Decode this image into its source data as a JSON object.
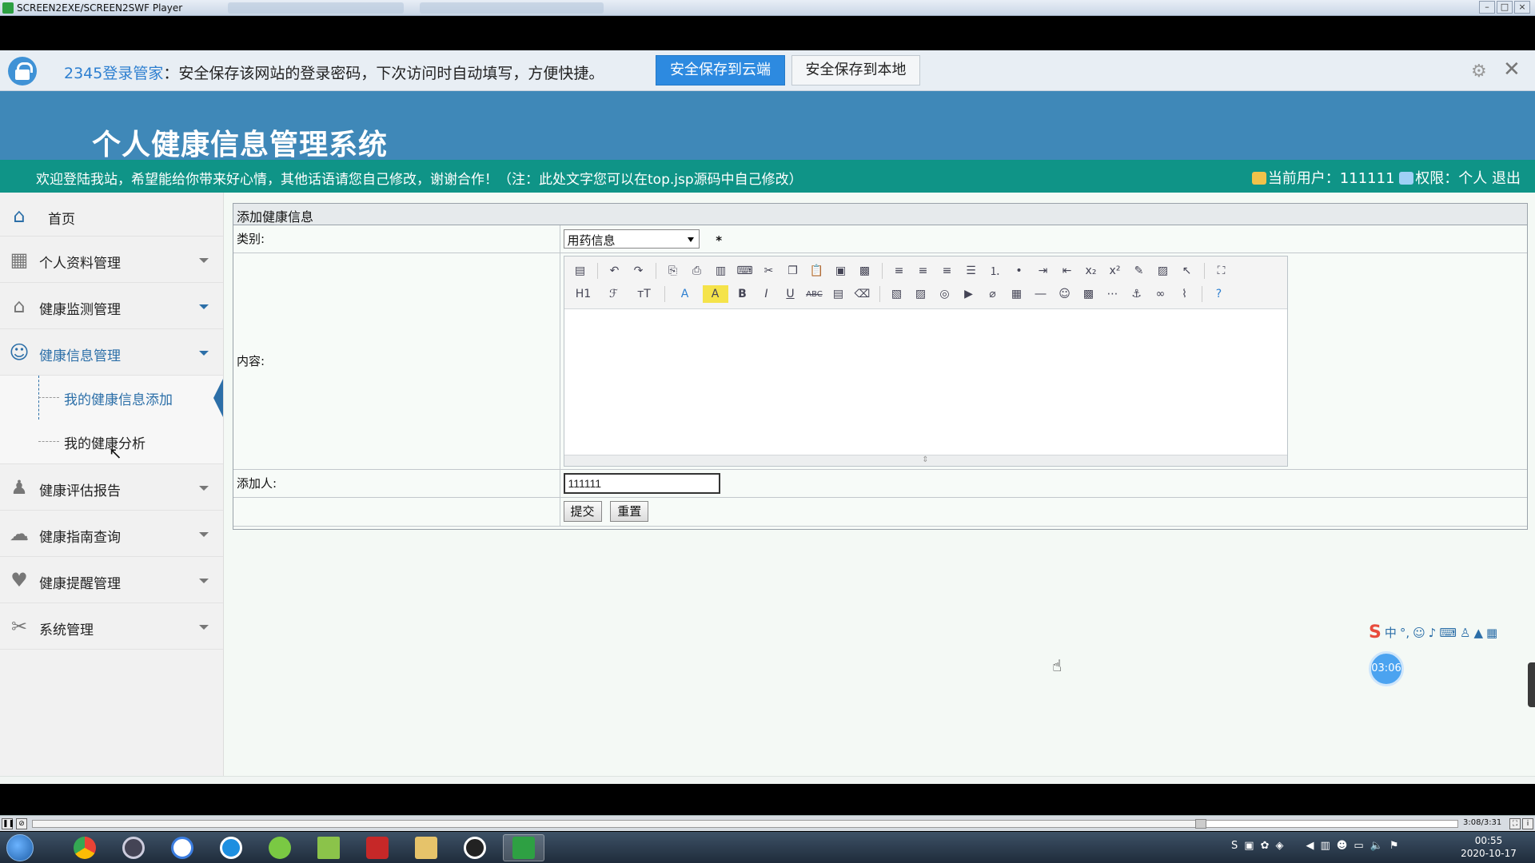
{
  "window": {
    "title": "SCREEN2EXE/SCREEN2SWF Player"
  },
  "password_bar": {
    "brand": "2345登录管家",
    "message": "：安全保存该网站的登录密码，下次访问时自动填写，方便快捷。",
    "save_cloud": "安全保存到云端",
    "save_local": "安全保存到本地",
    "settings_icon": "gear-icon",
    "close_icon": "close-icon"
  },
  "header": {
    "title": "个人健康信息管理系统",
    "welcome": "欢迎登陆我站，希望能给你带来好心情，其他话语请您自己修改，谢谢合作！（注：此处文字您可以在top.jsp源码中自己修改）",
    "current_user_label": "当前用户：111111",
    "permission_label": "权限：个人",
    "logout": "退出"
  },
  "sidebar": {
    "home": "首页",
    "items": [
      {
        "label": "个人资料管理",
        "icon": "grid-icon"
      },
      {
        "label": "健康监测管理",
        "icon": "house-icon"
      },
      {
        "label": "健康信息管理",
        "icon": "users-icon"
      },
      {
        "label": "健康评估报告",
        "icon": "user-icon"
      },
      {
        "label": "健康指南查询",
        "icon": "chat-icon"
      },
      {
        "label": "健康提醒管理",
        "icon": "heart-icon"
      },
      {
        "label": "系统管理",
        "icon": "tools-icon"
      }
    ],
    "sub_items": [
      {
        "label": "我的健康信息添加"
      },
      {
        "label": "我的健康分析"
      }
    ]
  },
  "form": {
    "panel_title": "添加健康信息",
    "category_label": "类别:",
    "category_value": "用药信息",
    "required_mark": "*",
    "content_label": "内容:",
    "adder_label": "添加人:",
    "adder_value": "111111",
    "submit": "提交",
    "reset": "重置",
    "editor_row2": {
      "heading": "H1",
      "font": "ℱ",
      "size": "тT",
      "color": "A"
    }
  },
  "widgets": {
    "ime": {
      "brand": "S",
      "mode": "中"
    },
    "timer": "03:06"
  },
  "player": {
    "time": "3:08/3:31",
    "progress": 0.82
  },
  "taskbar": {
    "time": "00:55",
    "date": "2020-10-17"
  }
}
